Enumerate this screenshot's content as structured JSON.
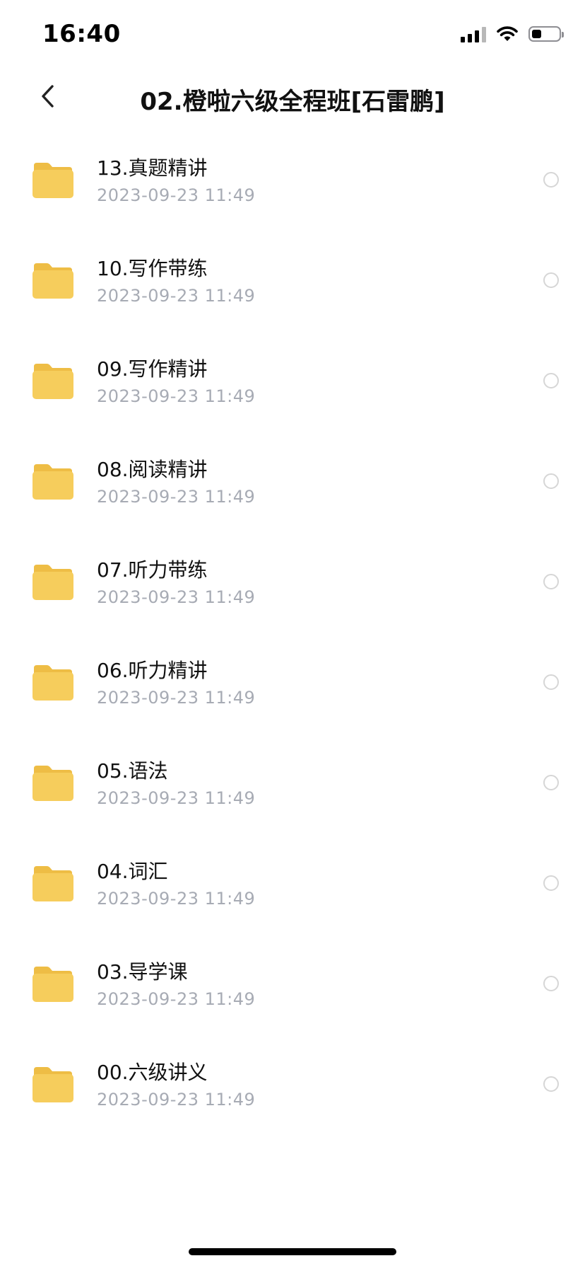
{
  "status_bar": {
    "time": "16:40",
    "signal_icon": "cellular-signal-icon",
    "wifi_icon": "wifi-icon",
    "battery_icon": "battery-icon",
    "battery_level": 0.35
  },
  "nav": {
    "back_icon": "chevron-left-icon",
    "title": "02.橙啦六级全程班[石雷鹏]"
  },
  "colors": {
    "folder": "#f6cd5c",
    "folder_tab": "#eebd45",
    "date_text": "#a7abb4",
    "radio_border": "#d6d6d6"
  },
  "folders": [
    {
      "name": "13.真题精讲",
      "date": "2023-09-23 11:49"
    },
    {
      "name": "10.写作带练",
      "date": "2023-09-23 11:49"
    },
    {
      "name": "09.写作精讲",
      "date": "2023-09-23 11:49"
    },
    {
      "name": "08.阅读精讲",
      "date": "2023-09-23 11:49"
    },
    {
      "name": "07.听力带练",
      "date": "2023-09-23 11:49"
    },
    {
      "name": "06.听力精讲",
      "date": "2023-09-23 11:49"
    },
    {
      "name": "05.语法",
      "date": "2023-09-23 11:49"
    },
    {
      "name": "04.词汇",
      "date": "2023-09-23 11:49"
    },
    {
      "name": "03.导学课",
      "date": "2023-09-23 11:49"
    },
    {
      "name": "00.六级讲义",
      "date": "2023-09-23 11:49"
    }
  ]
}
